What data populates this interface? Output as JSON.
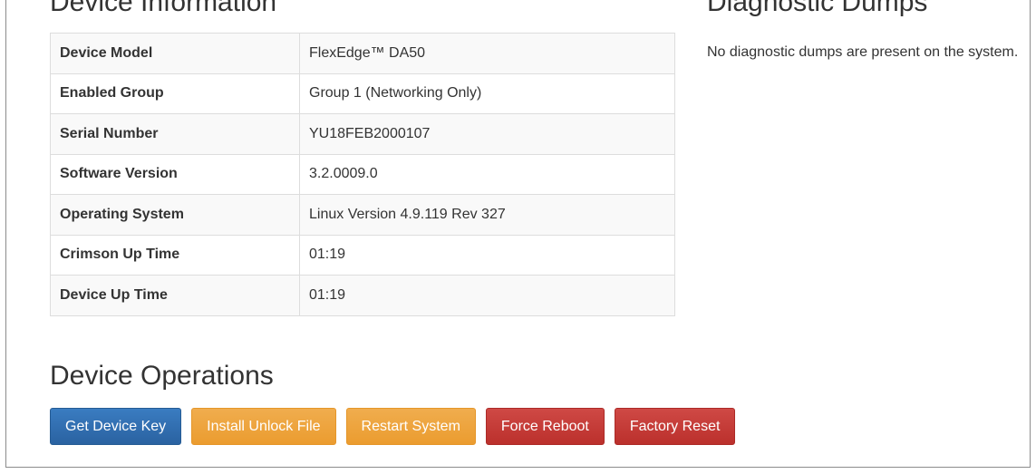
{
  "device_info": {
    "title": "Device Information",
    "rows": [
      {
        "label": "Device Model",
        "value": "FlexEdge™ DA50"
      },
      {
        "label": "Enabled Group",
        "value": "Group 1 (Networking Only)"
      },
      {
        "label": "Serial Number",
        "value": "YU18FEB2000107"
      },
      {
        "label": "Software Version",
        "value": "3.2.0009.0"
      },
      {
        "label": "Operating System",
        "value": "Linux Version 4.9.119 Rev 327"
      },
      {
        "label": "Crimson Up Time",
        "value": "01:19"
      },
      {
        "label": "Device Up Time",
        "value": "01:19"
      }
    ]
  },
  "diagnostic_dumps": {
    "title": "Diagnostic Dumps",
    "message": "No diagnostic dumps are present on the system."
  },
  "device_operations": {
    "title": "Device Operations",
    "buttons": {
      "get_key": "Get Device Key",
      "install_unlock": "Install Unlock File",
      "restart": "Restart System",
      "force_reboot": "Force Reboot",
      "factory_reset": "Factory Reset"
    }
  },
  "colors": {
    "primary": "#2f6eb0",
    "warning": "#eea43e",
    "danger": "#c43d39"
  }
}
